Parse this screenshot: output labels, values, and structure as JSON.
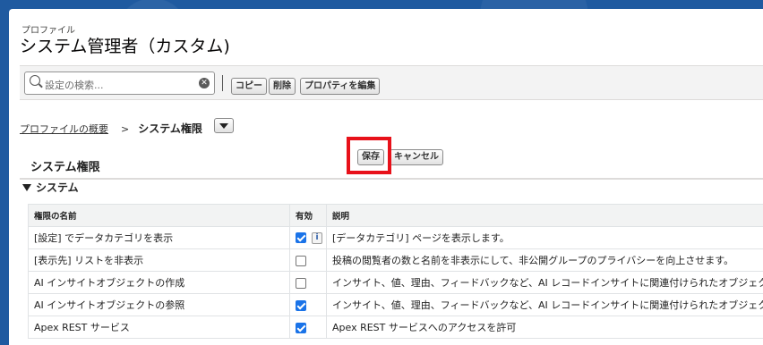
{
  "header": {
    "sub_title": "プロファイル",
    "title": "システム管理者（カスタム)"
  },
  "toolbar": {
    "search_placeholder": "設定の検索...",
    "copy_label": "コピー",
    "delete_label": "削除",
    "edit_props_label": "プロパティを編集"
  },
  "breadcrumb": {
    "parent": "プロファイルの概要",
    "separator": ">",
    "current": "システム権限"
  },
  "section": {
    "title": "システム権限",
    "save_label": "保存",
    "cancel_label": "キャンセル",
    "subsection_title": "システム"
  },
  "table": {
    "headers": [
      "権限の名前",
      "有効",
      "説明"
    ],
    "rows": [
      {
        "name": "[設定] でデータカテゴリを表示",
        "enabled": true,
        "has_info": true,
        "desc": "[データカテゴリ] ページを表示します。"
      },
      {
        "name": "[表示先] リストを非表示",
        "enabled": false,
        "has_info": false,
        "desc": "投稿の閲覧者の数と名前を非表示にして、非公開グループのプライバシーを向上させます。"
      },
      {
        "name": "AI インサイトオブジェクトの作成",
        "enabled": false,
        "has_info": false,
        "desc": "インサイト、値、理由、フィードバックなど、AI レコードインサイトに関連付けられたオブジェク"
      },
      {
        "name": "AI インサイトオブジェクトの参照",
        "enabled": true,
        "has_info": false,
        "desc": "インサイト、値、理由、フィードバックなど、AI レコードインサイトに関連付けられたオブジェク"
      },
      {
        "name": "Apex REST サービス",
        "enabled": true,
        "has_info": false,
        "desc": "Apex REST サービスへのアクセスを許可"
      }
    ]
  },
  "colors": {
    "background": "#1f5aa0",
    "highlight": "#e8111a",
    "checkbox_on": "#1a73e8"
  }
}
